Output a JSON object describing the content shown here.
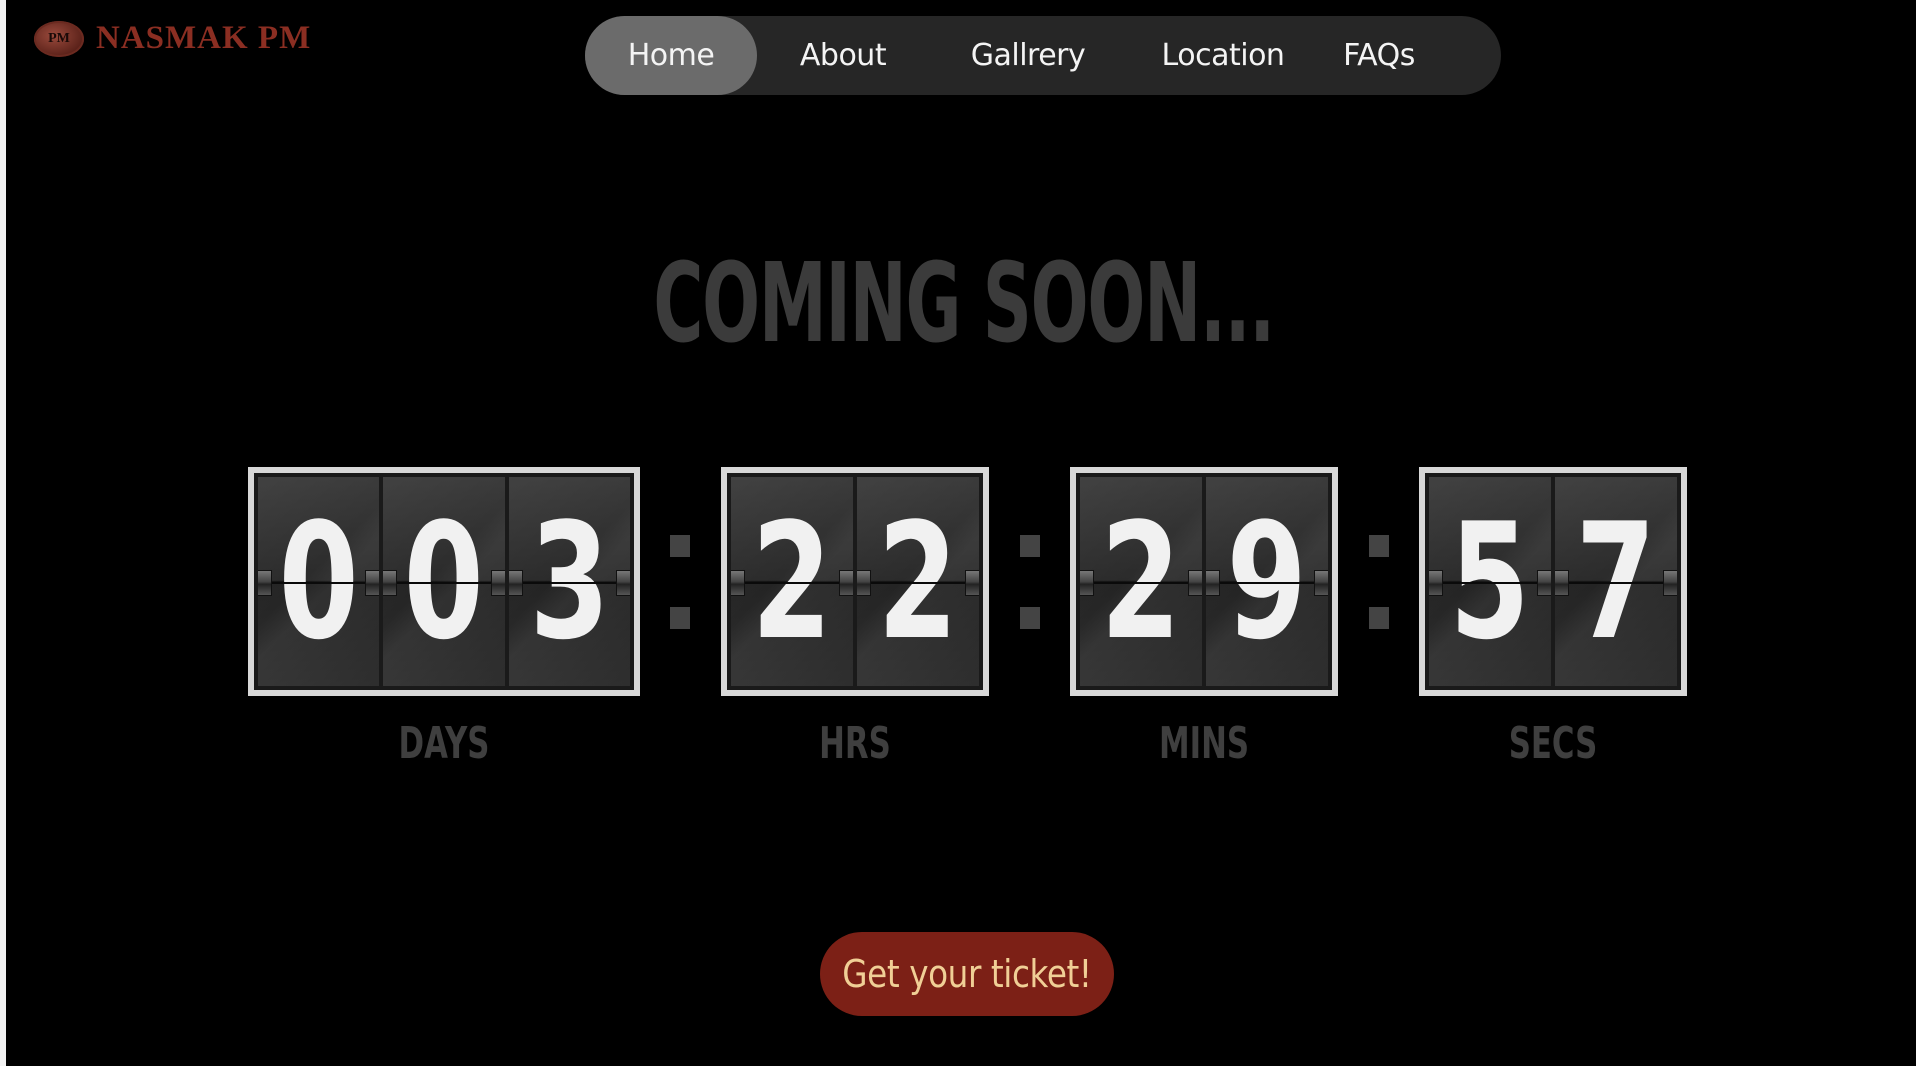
{
  "brand": {
    "badge_text": "PM",
    "name": "NASMAK PM",
    "color": "#8b2e22"
  },
  "nav": {
    "items": [
      {
        "label": "Home",
        "active": true
      },
      {
        "label": "About",
        "active": false
      },
      {
        "label": "Gallrery",
        "active": false
      },
      {
        "label": "Location",
        "active": false
      },
      {
        "label": "FAQs",
        "active": false
      }
    ]
  },
  "hero": {
    "title": "COMING SOON..."
  },
  "countdown": {
    "units": [
      {
        "label": "DAYS",
        "digits": [
          "0",
          "0",
          "3"
        ]
      },
      {
        "label": "HRS",
        "digits": [
          "2",
          "2"
        ]
      },
      {
        "label": "MINS",
        "digits": [
          "2",
          "9"
        ]
      },
      {
        "label": "SECS",
        "digits": [
          "5",
          "7"
        ]
      }
    ],
    "separator": ":"
  },
  "cta": {
    "label": "Get your ticket!",
    "background": "#7c2016",
    "text_color": "#f0cf96"
  }
}
